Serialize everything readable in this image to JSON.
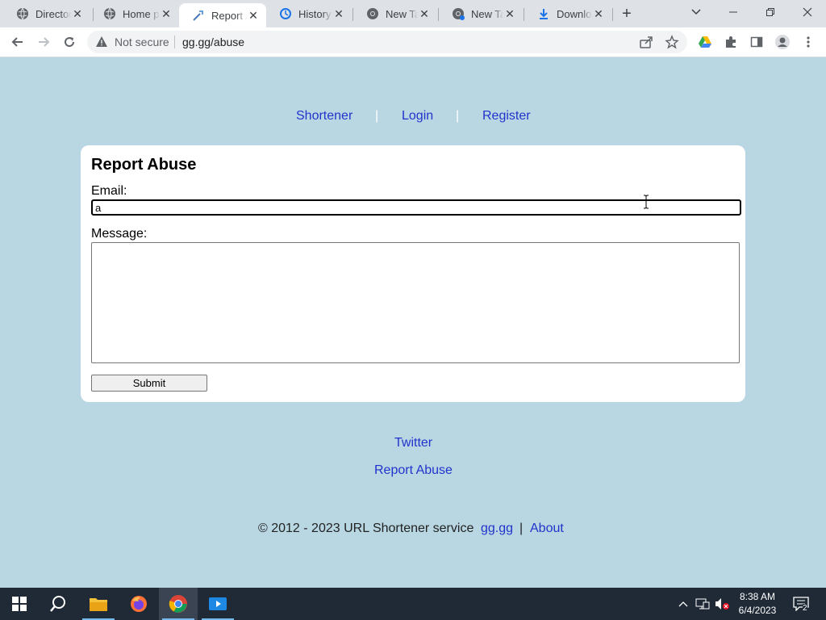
{
  "browser": {
    "tabs": [
      {
        "label": "Directory",
        "icon": "globe-icon"
      },
      {
        "label": "Home page",
        "icon": "globe-icon"
      },
      {
        "label": "Report Abuse",
        "icon": "link-icon",
        "active": true
      },
      {
        "label": "History",
        "icon": "history-icon"
      },
      {
        "label": "New Tab",
        "icon": "chrome-icon"
      },
      {
        "label": "New Tab",
        "icon": "chrome-icon"
      },
      {
        "label": "Downloads",
        "icon": "download-icon"
      }
    ],
    "security_label": "Not secure",
    "url": "gg.gg/abuse"
  },
  "nav": {
    "shortener": "Shortener",
    "login": "Login",
    "register": "Register",
    "separator": "|"
  },
  "form": {
    "title": "Report Abuse",
    "email_label": "Email:",
    "email_value": "a",
    "message_label": "Message:",
    "message_value": "",
    "submit_label": "Submit"
  },
  "footer": {
    "twitter": "Twitter",
    "report_abuse": "Report Abuse",
    "copyright": "© 2012 - 2023 URL Shortener service",
    "site_link": "gg.gg",
    "divider": "|",
    "about": "About"
  },
  "taskbar": {
    "time": "8:38 AM",
    "date": "6/4/2023",
    "notification_count": "2"
  },
  "colors": {
    "page_bg": "#b8d7e3",
    "link": "#2233cc",
    "card_bg": "#ffffff"
  }
}
